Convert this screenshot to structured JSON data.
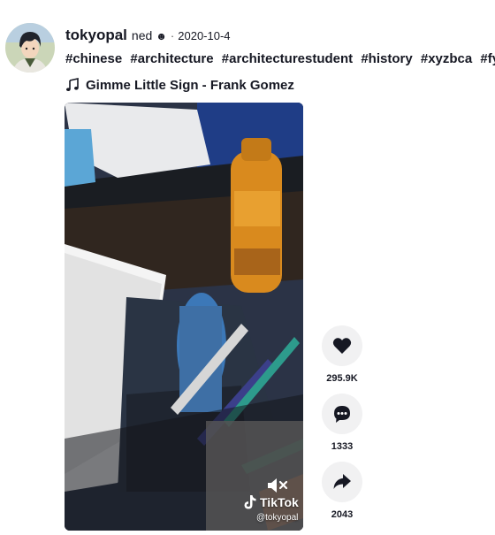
{
  "post": {
    "author": {
      "username": "tokyopal",
      "nickname": "ned",
      "nickname_icon": "☻",
      "separator": "·",
      "date": "2020-10-4"
    },
    "caption": {
      "hashtags": [
        "#chinese",
        "#architecture",
        "#architecturestudent",
        "#history",
        "#xyzbca",
        "#fyp"
      ]
    },
    "music": {
      "icon": "music-note-icon",
      "title": "Gimme Little Sign - Frank Gomez"
    },
    "video": {
      "watermark": "TikTok",
      "handle": "@tokyopal"
    },
    "actions": [
      {
        "name": "like",
        "icon": "heart-icon",
        "count": "295.9K"
      },
      {
        "name": "comment",
        "icon": "comment-icon",
        "count": "1333"
      },
      {
        "name": "share",
        "icon": "share-icon",
        "count": "2043"
      }
    ]
  },
  "colors": {
    "text": "#161823",
    "action_bg": "#f1f1f2",
    "video_bg": "#2a3446"
  }
}
